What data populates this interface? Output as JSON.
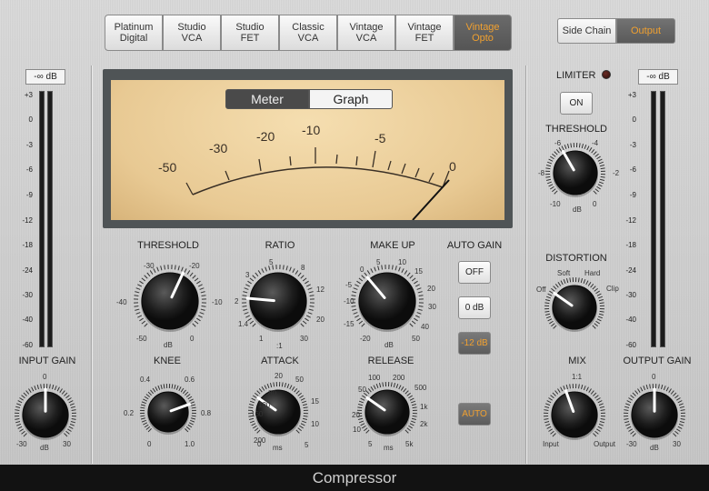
{
  "models": [
    {
      "label": "Platinum\nDigital",
      "active": false
    },
    {
      "label": "Studio\nVCA",
      "active": false
    },
    {
      "label": "Studio\nFET",
      "active": false
    },
    {
      "label": "Classic\nVCA",
      "active": false
    },
    {
      "label": "Vintage\nVCA",
      "active": false
    },
    {
      "label": "Vintage\nFET",
      "active": false
    },
    {
      "label": "Vintage\nOpto",
      "active": true
    }
  ],
  "sidechain": {
    "side_chain_label": "Side Chain",
    "output_label": "Output",
    "selected": "Output"
  },
  "input_meter": {
    "readout": "-∞ dB",
    "scale": [
      "+3",
      "0",
      "-3",
      "-6",
      "-9",
      "-12",
      "-18",
      "-24",
      "-30",
      "-40",
      "-60"
    ]
  },
  "output_meter": {
    "readout": "-∞ dB",
    "scale": [
      "+3",
      "0",
      "-3",
      "-6",
      "-9",
      "-12",
      "-18",
      "-24",
      "-30",
      "-40",
      "-60"
    ]
  },
  "vu": {
    "tabs": {
      "meter": "Meter",
      "graph": "Graph",
      "selected": "Meter"
    },
    "scale_labels": [
      "-50",
      "-30",
      "-20",
      "-10",
      "-5",
      "0"
    ]
  },
  "controls": {
    "threshold": {
      "label": "THRESHOLD",
      "ticks": [
        "-30",
        "-20",
        "-40",
        "-10",
        "-50",
        "0"
      ],
      "unit": "dB"
    },
    "ratio": {
      "label": "RATIO",
      "ticks": [
        "5",
        "8",
        "3",
        "12",
        "2",
        "20",
        "1.4",
        "30",
        "1"
      ],
      "unit": ":1"
    },
    "makeup": {
      "label": "MAKE UP",
      "ticks": [
        "0",
        "5",
        "10",
        "-5",
        "15",
        "-10",
        "30",
        "-15",
        "40",
        "-20",
        "50"
      ],
      "extra_ticks": [
        "20"
      ],
      "unit": "dB"
    },
    "knee": {
      "label": "KNEE",
      "ticks": [
        "0.4",
        "0.6",
        "0.2",
        "0.8",
        "0",
        "1.0"
      ]
    },
    "attack": {
      "label": "ATTACK",
      "ticks": [
        "20",
        "50",
        "80",
        "15",
        "120",
        "10",
        "160",
        "5",
        "200",
        "0"
      ],
      "unit": "ms"
    },
    "release": {
      "label": "RELEASE",
      "ticks": [
        "100",
        "200",
        "50",
        "500",
        "20",
        "1k",
        "10",
        "2k",
        "5",
        "5k"
      ],
      "unit": "ms"
    },
    "input_gain": {
      "label": "INPUT GAIN",
      "ticks": [
        "0",
        "-30",
        "30"
      ],
      "unit": "dB"
    },
    "output_gain": {
      "label": "OUTPUT GAIN",
      "ticks": [
        "0",
        "-30",
        "30"
      ],
      "unit": "dB"
    },
    "limiter": {
      "label": "LIMITER",
      "button": "ON"
    },
    "limiter_threshold": {
      "label": "THRESHOLD",
      "ticks": [
        "-6",
        "-4",
        "-8",
        "-2",
        "-10",
        "0"
      ],
      "unit": "dB"
    },
    "distortion": {
      "label": "DISTORTION",
      "ticks": [
        "Soft",
        "Hard",
        "Off",
        "Clip"
      ]
    },
    "mix": {
      "label": "MIX",
      "ticks": [
        "1:1",
        "Input",
        "Output"
      ]
    }
  },
  "auto_gain": {
    "label": "AUTO GAIN",
    "off": "OFF",
    "zero": "0 dB",
    "minus12": "-12 dB",
    "selected": "-12 dB"
  },
  "auto_release": {
    "label": "AUTO",
    "active": true
  },
  "footer": {
    "title": "Compressor"
  },
  "colors": {
    "accent": "#f0a030",
    "vu_face": "#ebcc97"
  }
}
